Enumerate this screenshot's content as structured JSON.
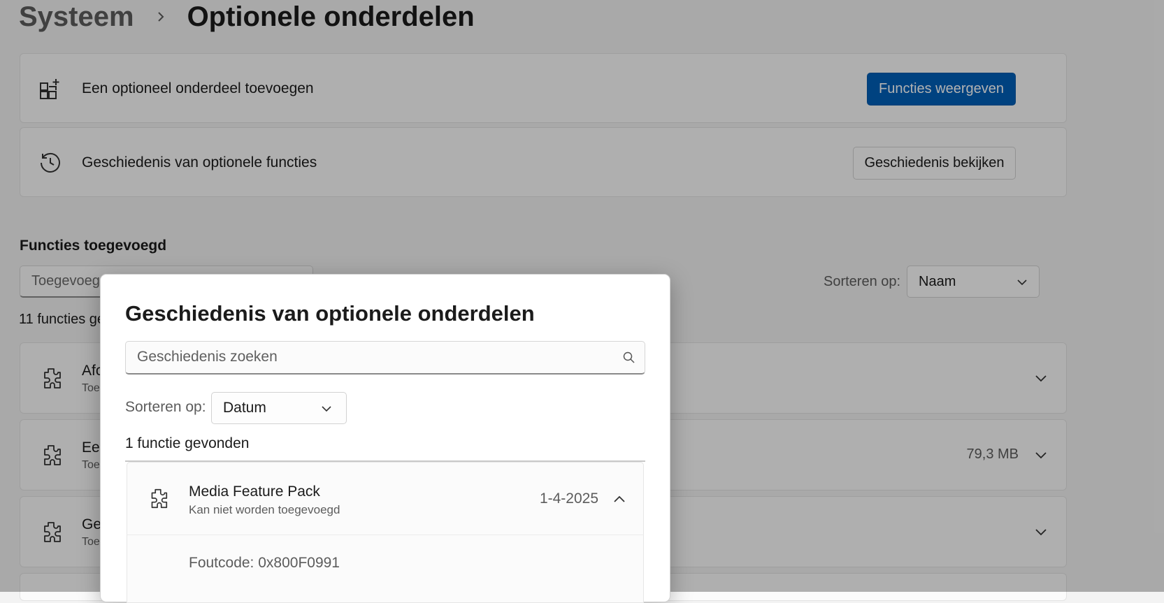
{
  "breadcrumb": {
    "parent": "Systeem",
    "current": "Optionele onderdelen"
  },
  "add_card": {
    "label": "Een optioneel onderdeel toevoegen",
    "button": "Functies weergeven"
  },
  "history_card": {
    "label": "Geschiedenis van optionele functies",
    "button": "Geschiedenis bekijken"
  },
  "installed": {
    "title": "Functies toegevoegd",
    "filter_partial": "Toegevoeg",
    "sort_label": "Sorteren op:",
    "sort_value": "Naam",
    "count_partial": "11 functies ge",
    "rows": [
      {
        "name_partial": "Afc",
        "status_partial": "Toe",
        "size": ""
      },
      {
        "name_partial": "Een",
        "status_partial": "Toe",
        "size": "79,3 MB"
      },
      {
        "name_partial": "Ge",
        "status_partial": "Toe",
        "size": ""
      }
    ]
  },
  "dialog": {
    "title": "Geschiedenis van optionele onderdelen",
    "search_placeholder": "Geschiedenis zoeken",
    "sort_label": "Sorteren op:",
    "sort_value": "Datum",
    "count": "1 functie gevonden",
    "items": [
      {
        "name": "Media Feature Pack",
        "status": "Kan niet worden toegevoegd",
        "date": "1-4-2025",
        "error": "Foutcode: 0x800F0991"
      }
    ]
  },
  "colors": {
    "accent": "#005fb8",
    "overlay": "rgba(0,0,0,0.30)"
  },
  "icons": [
    "chevron-right-icon",
    "add-apps-icon",
    "history-icon",
    "puzzle-icon",
    "chevron-down-icon",
    "chevron-up-icon",
    "search-icon"
  ]
}
